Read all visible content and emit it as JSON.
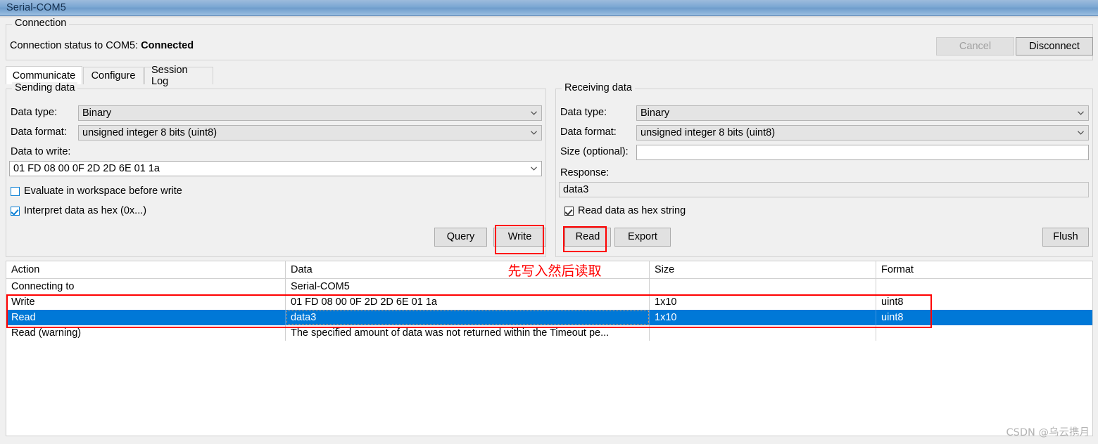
{
  "window": {
    "title": "Serial-COM5"
  },
  "connection": {
    "group_label": "Connection",
    "status_prefix": "Connection status to COM5: ",
    "status_value": "Connected",
    "cancel_label": "Cancel",
    "disconnect_label": "Disconnect"
  },
  "tabs": [
    {
      "label": "Communicate",
      "active": true
    },
    {
      "label": "Configure",
      "active": false
    },
    {
      "label": "Session Log",
      "active": false
    }
  ],
  "sending": {
    "group_label": "Sending data",
    "data_type_label": "Data type:",
    "data_type_value": "Binary",
    "data_format_label": "Data format:",
    "data_format_value": "unsigned integer 8 bits (uint8)",
    "data_to_write_label": "Data to write:",
    "data_to_write_value": "01 FD 08 00 0F 2D 2D 6E 01 1a",
    "evaluate_checkbox_label": "Evaluate in workspace before write",
    "evaluate_checked": false,
    "hex_checkbox_label": "Interpret data as hex (0x...)",
    "hex_checked": true,
    "query_label": "Query",
    "write_label": "Write"
  },
  "receiving": {
    "group_label": "Receiving data",
    "data_type_label": "Data type:",
    "data_type_value": "Binary",
    "data_format_label": "Data format:",
    "data_format_value": "unsigned integer 8 bits (uint8)",
    "size_label": "Size (optional):",
    "size_value": "",
    "response_label": "Response:",
    "response_value": "data3",
    "hex_checkbox_label": "Read data as hex string",
    "hex_checked": true,
    "read_label": "Read",
    "export_label": "Export",
    "flush_label": "Flush"
  },
  "log": {
    "columns": [
      "Action",
      "Data",
      "Size",
      "Format"
    ],
    "rows": [
      {
        "action": "Connecting to",
        "data": "Serial-COM5",
        "size": "",
        "format": "",
        "selected": false
      },
      {
        "action": "Write",
        "data": "01 FD 08 00 0F 2D 2D 6E 01 1a",
        "size": "1x10",
        "format": "uint8",
        "selected": false
      },
      {
        "action": "Read",
        "data": "data3",
        "size": "1x10",
        "format": "uint8",
        "selected": true
      },
      {
        "action": "Read (warning)",
        "data": "The specified amount of data was not returned within the Timeout pe...",
        "size": "",
        "format": "",
        "selected": false
      }
    ]
  },
  "annotations": {
    "chinese_note": "先写入然后读取",
    "highlight_color": "#ff0000"
  },
  "watermark": {
    "text": "CSDN @乌云携月"
  },
  "icons": {
    "chevron_down": "chevron-down-icon"
  }
}
